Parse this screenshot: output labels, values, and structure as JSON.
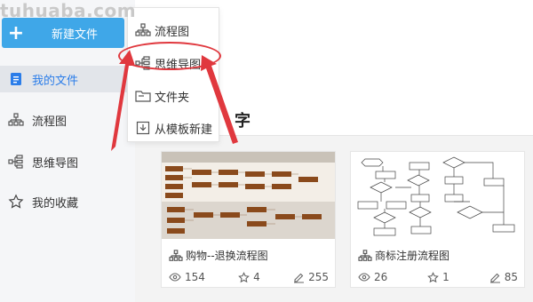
{
  "watermark": "tuhuaba.com",
  "colors": {
    "accent": "#3fa7e8",
    "active_text": "#2b7de9",
    "annotation_red": "#e0383e"
  },
  "sidebar": {
    "new_button": {
      "icon": "plus-icon",
      "label": "新建文件"
    },
    "items": [
      {
        "icon": "document-icon",
        "label": "我的文件",
        "active": true
      },
      {
        "icon": "flowchart-icon",
        "label": "流程图"
      },
      {
        "icon": "mindmap-icon",
        "label": "思维导图"
      },
      {
        "icon": "star-icon",
        "label": "我的收藏"
      }
    ]
  },
  "dropdown": {
    "items": [
      {
        "icon": "flowchart-icon",
        "label": "流程图"
      },
      {
        "icon": "mindmap-icon",
        "label": "思维导图"
      },
      {
        "icon": "folder-icon",
        "label": "文件夹"
      },
      {
        "icon": "template-icon",
        "label": "从模板新建"
      }
    ]
  },
  "main": {
    "section_title": "字"
  },
  "cards": [
    {
      "title": "购物--退换流程图",
      "views": "154",
      "likes": "4",
      "edits": "255"
    },
    {
      "title": "商标注册流程图",
      "views": "26",
      "likes": "1",
      "edits": "85"
    }
  ]
}
